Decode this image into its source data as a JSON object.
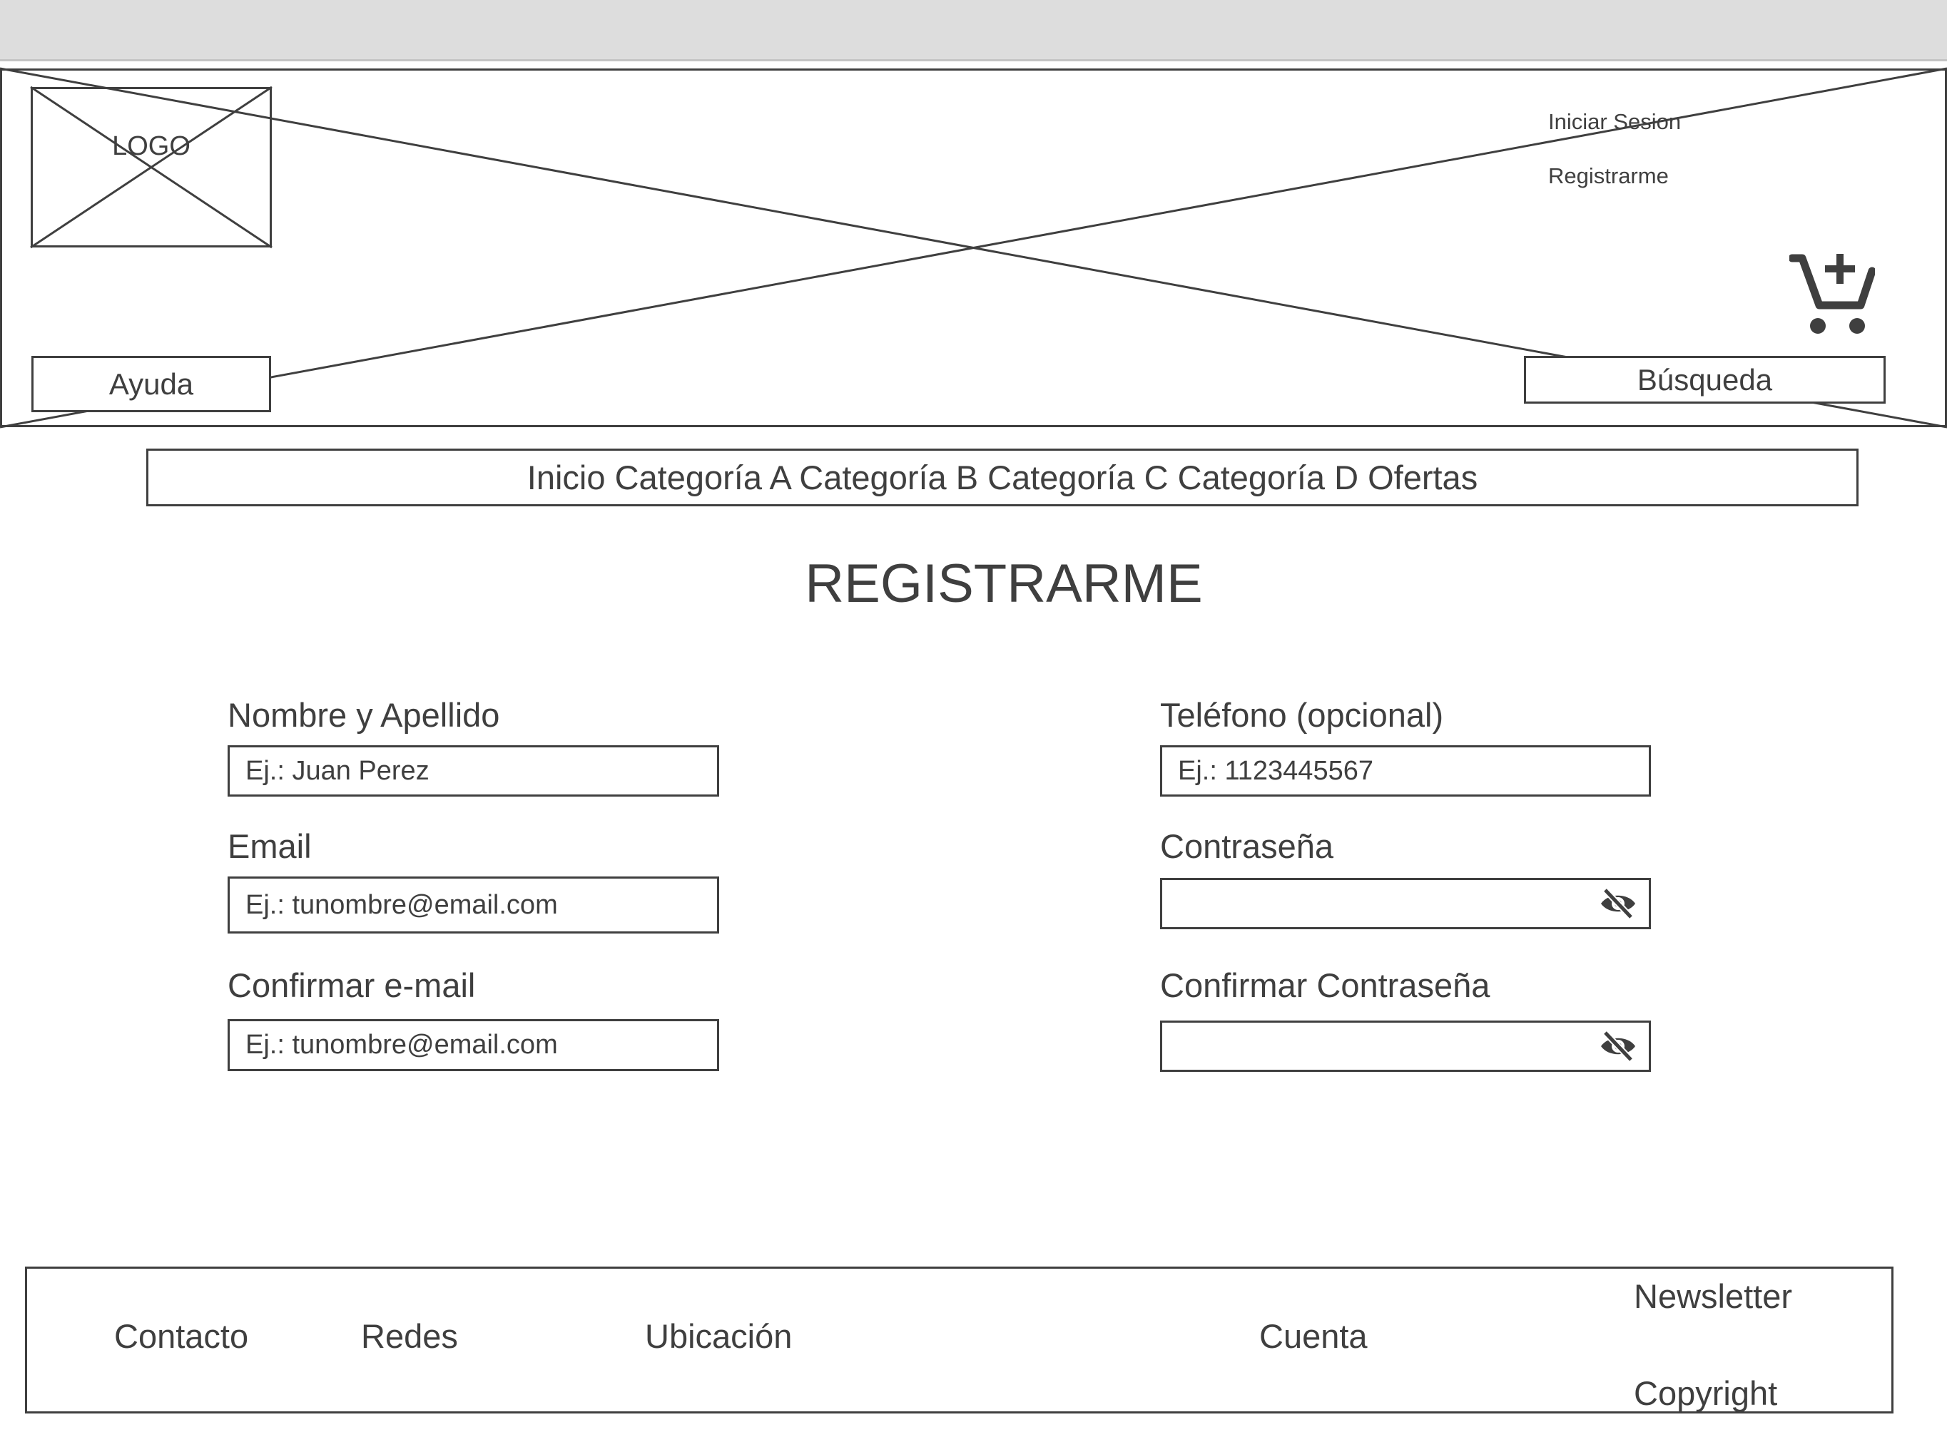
{
  "header": {
    "logo_text": "LOGO",
    "login_link": "Iniciar Sesion",
    "register_link": "Registrarme",
    "help_button": "Ayuda",
    "search_button": "Búsqueda",
    "cart_icon": "cart-plus-icon"
  },
  "nav": {
    "items": [
      "Inicio",
      "Categoría A",
      "Categoría B",
      "Categoría C",
      "Categoría D",
      "Ofertas"
    ]
  },
  "page": {
    "title": "REGISTRARME"
  },
  "form": {
    "name": {
      "label": "Nombre y Apellido",
      "placeholder": "Ej.: Juan Perez"
    },
    "email": {
      "label": "Email",
      "placeholder": "Ej.: tunombre@email.com"
    },
    "confirm_email": {
      "label": "Confirmar e-mail",
      "placeholder": "Ej.: tunombre@email.com"
    },
    "phone": {
      "label": "Teléfono (opcional)",
      "placeholder": "Ej.: 1123445567"
    },
    "password": {
      "label": "Contraseña",
      "placeholder": "",
      "icon": "eye-off-icon"
    },
    "confirm_password": {
      "label": "Confirmar Contraseña",
      "placeholder": "",
      "icon": "eye-off-icon"
    }
  },
  "footer": {
    "contact": "Contacto",
    "social": "Redes",
    "location": "Ubicación",
    "account": "Cuenta",
    "newsletter": "Newsletter",
    "copyright": "Copyright"
  },
  "colors": {
    "stroke": "#3f3f3f",
    "topbar": "#dddddd",
    "background": "#ffffff"
  }
}
